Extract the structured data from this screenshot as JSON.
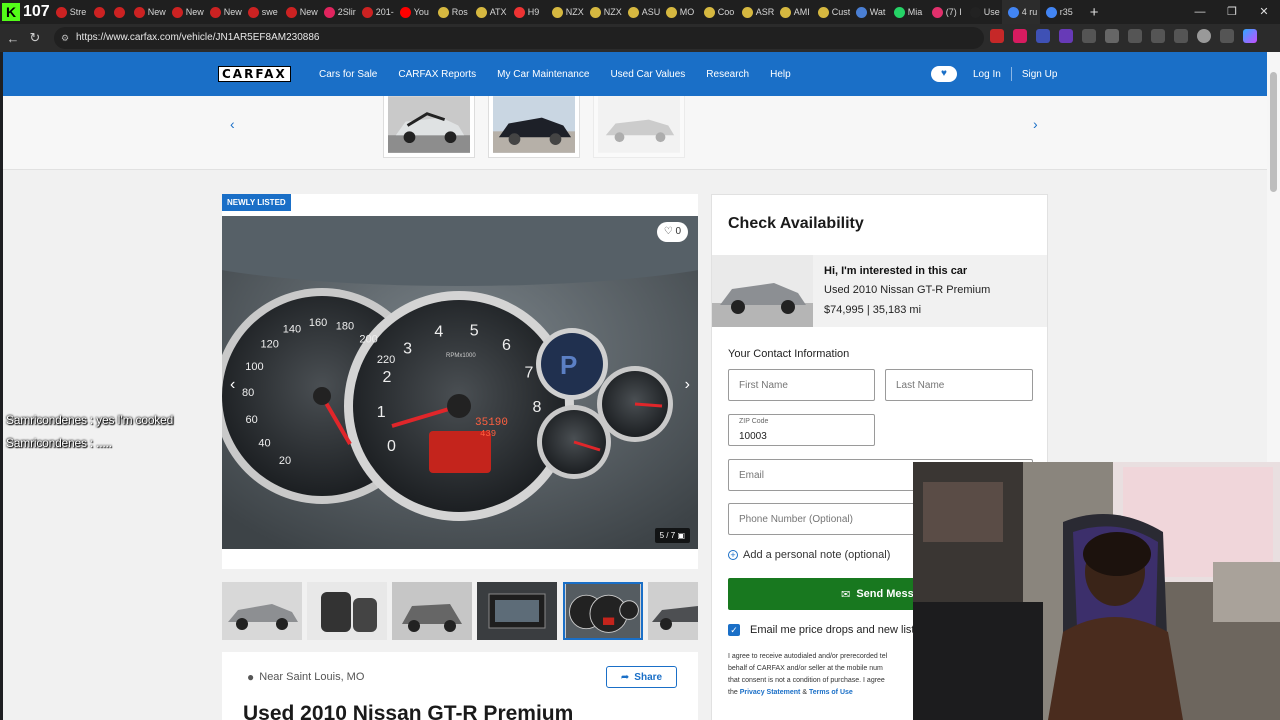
{
  "browser": {
    "tab_counter": "107",
    "tabs": [
      {
        "label": "Stre",
        "color": "#cc2222"
      },
      {
        "label": "",
        "color": "#cc2222"
      },
      {
        "label": "",
        "color": "#cc2222"
      },
      {
        "label": "New",
        "color": "#cc2222"
      },
      {
        "label": "New",
        "color": "#cc2222"
      },
      {
        "label": "New",
        "color": "#cc2222"
      },
      {
        "label": "swe",
        "color": "#cc2222"
      },
      {
        "label": "New",
        "color": "#cc2222"
      },
      {
        "label": "2Slir",
        "color": "#e0245e"
      },
      {
        "label": "201-",
        "color": "#cc2222"
      },
      {
        "label": "You",
        "color": "#ff0000"
      },
      {
        "label": "Ros",
        "color": "#d6b840"
      },
      {
        "label": "ATX",
        "color": "#d6b840"
      },
      {
        "label": "H9",
        "color": "#e33"
      },
      {
        "label": "NZX",
        "color": "#d6b840"
      },
      {
        "label": "NZX",
        "color": "#d6b840"
      },
      {
        "label": "ASU",
        "color": "#d6b840"
      },
      {
        "label": "MO",
        "color": "#d6b840"
      },
      {
        "label": "Coo",
        "color": "#d6b840"
      },
      {
        "label": "ASR",
        "color": "#d6b840"
      },
      {
        "label": "AMI",
        "color": "#d6b840"
      },
      {
        "label": "Cust",
        "color": "#d6b840"
      },
      {
        "label": "Wat",
        "color": "#4a7fd4"
      },
      {
        "label": "Mia",
        "color": "#25d366"
      },
      {
        "label": "(7) I",
        "color": "#e1306c"
      },
      {
        "label": "Use",
        "color": "#222222"
      },
      {
        "label": "4 ru",
        "color": "#4285f4"
      },
      {
        "label": "r35",
        "color": "#4285f4"
      }
    ],
    "new_tab": "+",
    "url": "https://www.carfax.com/vehicle/JN1AR5EF8AM230886",
    "window_controls": [
      "—",
      "❐",
      "✕"
    ]
  },
  "site": {
    "logo": "CARFAX",
    "nav": [
      "Cars for Sale",
      "CARFAX Reports",
      "My Car Maintenance",
      "Used Car Values",
      "Research",
      "Help"
    ],
    "login": "Log In",
    "signup": "Sign Up"
  },
  "listing": {
    "badge": "NEWLY LISTED",
    "favorites": "0",
    "photo_counter": "5 / 7",
    "location": "Near Saint Louis, MO",
    "share": "Share",
    "title": "Used 2010 Nissan GT-R Premium"
  },
  "cluster": {
    "tach_labels": [
      "1",
      "2",
      "3",
      "4",
      "5",
      "6",
      "7",
      "8",
      "0"
    ],
    "speed_labels": [
      "20",
      "40",
      "60",
      "80",
      "100",
      "120",
      "140",
      "160",
      "180",
      "200",
      "220"
    ],
    "rpm_unit": "RPMx1000",
    "odometer": "35190",
    "trip": "439",
    "gear": "P"
  },
  "availability": {
    "title": "Check Availability",
    "interest_line1": "Hi, I'm interested in this car",
    "interest_line2": "Used 2010 Nissan GT-R Premium",
    "interest_line3": "$74,995 | 35,183 mi",
    "contact_heading": "Your Contact Information",
    "first_name_placeholder": "First Name",
    "last_name_placeholder": "Last Name",
    "zip_label": "ZIP Code",
    "zip_value": "10003",
    "email_placeholder": "Email",
    "phone_placeholder": "Phone Number (Optional)",
    "note_link": "Add a personal note (optional)",
    "send_button": "Send Messa",
    "opt_in": "Email me price drops and new listi",
    "legal_1": "I agree to receive autodialed and/or prerecorded tel",
    "legal_2": "behalf of CARFAX and/or seller at the mobile num",
    "legal_3": "that consent is not a condition of purchase. I agree",
    "legal_4_prefix": "the",
    "legal_privacy": "Privacy Statement",
    "legal_and": "&",
    "legal_terms": "Terms of Use"
  },
  "chat": [
    {
      "text": "Samricondenes : yes I'm cooked"
    },
    {
      "text": "Samricondenes : ....."
    }
  ],
  "colors": {
    "brand_blue": "#1a6fc7",
    "send_green": "#18781f",
    "badge_blue": "#1a6fc7"
  }
}
